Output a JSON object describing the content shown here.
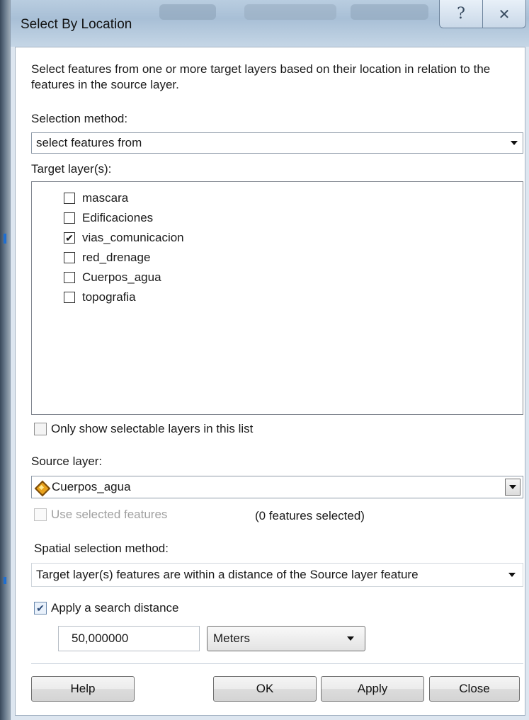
{
  "window": {
    "title": "Select By Location",
    "help_icon": "question-mark-icon",
    "close_icon": "close-x-icon"
  },
  "description": "Select features from one or more target layers based on their location in relation to the features in the source layer.",
  "selection_method": {
    "label": "Selection method:",
    "value": "select features from"
  },
  "target_layers": {
    "label": "Target layer(s):",
    "items": [
      {
        "label": "mascara",
        "checked": false
      },
      {
        "label": "Edificaciones",
        "checked": false
      },
      {
        "label": "vias_comunicacion",
        "checked": true
      },
      {
        "label": "red_drenage",
        "checked": false
      },
      {
        "label": "Cuerpos_agua",
        "checked": false
      },
      {
        "label": "topografia",
        "checked": false
      }
    ]
  },
  "only_selectable": {
    "label": "Only show selectable layers in this list",
    "checked": false
  },
  "source_layer": {
    "label": "Source layer:",
    "value": "Cuerpos_agua",
    "icon": "polygon-layer-icon"
  },
  "use_selected": {
    "label": "Use selected features",
    "checked": false,
    "enabled": false,
    "count_text": "(0 features selected)"
  },
  "spatial_method": {
    "label": "Spatial selection method:",
    "value": "Target layer(s) features are within a distance of the Source layer feature"
  },
  "search_distance": {
    "label": "Apply a search distance",
    "checked": true,
    "value": "50,000000",
    "units": "Meters"
  },
  "buttons": {
    "help": "Help",
    "ok": "OK",
    "apply": "Apply",
    "close": "Close"
  },
  "colors": {
    "title_bar": "#a8bfd6",
    "client_bg": "#ffffff",
    "frame": "#dde6f0"
  }
}
